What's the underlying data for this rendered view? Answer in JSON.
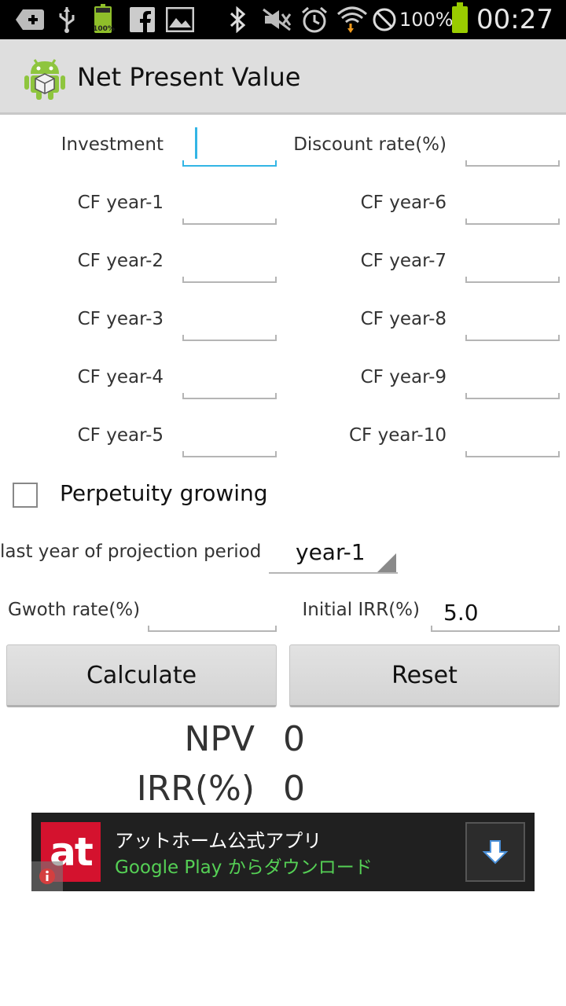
{
  "status_bar": {
    "battery_small_label": "100%",
    "battery_percent": "100%",
    "time": "00:27",
    "icons": [
      "add-notification-icon",
      "usb-icon",
      "battery-charging-icon",
      "facebook-icon",
      "gallery-icon",
      "bluetooth-icon",
      "mute-icon",
      "alarm-icon",
      "wifi-icon",
      "no-sim-icon",
      "battery-icon"
    ]
  },
  "app": {
    "title": "Net Present Value",
    "icon": "android-robot-icon"
  },
  "form": {
    "investment": {
      "label": "Investment",
      "value": ""
    },
    "discount_rate": {
      "label": "Discount rate(%)",
      "value": ""
    },
    "cf_left": [
      {
        "label": "CF year-1",
        "value": ""
      },
      {
        "label": "CF year-2",
        "value": ""
      },
      {
        "label": "CF year-3",
        "value": ""
      },
      {
        "label": "CF year-4",
        "value": ""
      },
      {
        "label": "CF year-5",
        "value": ""
      }
    ],
    "cf_right": [
      {
        "label": "CF year-6",
        "value": ""
      },
      {
        "label": "CF year-7",
        "value": ""
      },
      {
        "label": "CF year-8",
        "value": ""
      },
      {
        "label": "CF year-9",
        "value": ""
      },
      {
        "label": "CF year-10",
        "value": ""
      }
    ],
    "perpetuity": {
      "label": "Perpetuity growing",
      "checked": false
    },
    "projection": {
      "label": "last year of projection period",
      "selected": "year-1"
    },
    "growth_rate": {
      "label": "Gwoth rate(%)",
      "value": ""
    },
    "initial_irr": {
      "label": "Initial IRR(%)",
      "value": "5.0"
    }
  },
  "buttons": {
    "calculate": "Calculate",
    "reset": "Reset"
  },
  "results": {
    "npv_label": "NPV",
    "npv_value": "0",
    "irr_label": "IRR(%)",
    "irr_value": "0"
  },
  "ad": {
    "logo_text": "at",
    "title": "アットホーム公式アプリ",
    "subtitle": "Google Play からダウンロード",
    "logo_color": "#d4122e",
    "subtitle_color": "#55d055"
  },
  "colors": {
    "accent": "#33b5e5",
    "action_bar": "#dedede"
  }
}
